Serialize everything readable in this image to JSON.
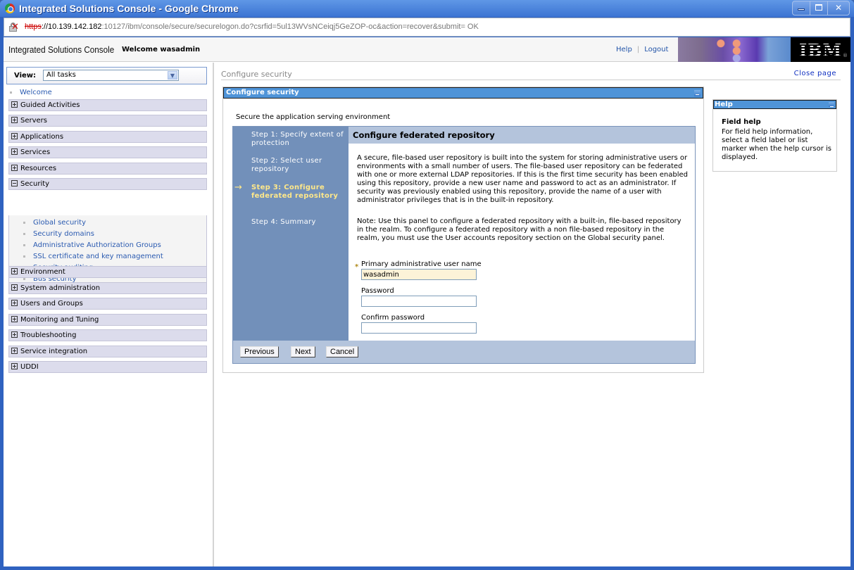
{
  "browser": {
    "window_title": "Integrated Solutions Console - Google Chrome",
    "url_protocol": "https",
    "url_host": "://10.139.142.182",
    "url_port": ":10127",
    "url_path": "/ibm/console/secure/securelogon.do?csrfid=5ul13WVsNCeiqj5GeZOP-oc&action=recover&submit= OK"
  },
  "banner": {
    "title": "Integrated Solutions Console",
    "welcome": "Welcome wasadmin",
    "help_link": "Help",
    "logout_link": "Logout",
    "separator": "|",
    "logo_text": "IBM",
    "logo_reg": "®"
  },
  "nav": {
    "view_label": "View:",
    "view_value": "All tasks",
    "welcome_link": "Welcome",
    "items": [
      {
        "label": "Guided Activities",
        "expanded": false
      },
      {
        "label": "Servers",
        "expanded": false
      },
      {
        "label": "Applications",
        "expanded": false
      },
      {
        "label": "Services",
        "expanded": false
      },
      {
        "label": "Resources",
        "expanded": false
      },
      {
        "label": "Security",
        "expanded": true
      },
      {
        "label": "Environment",
        "expanded": false
      },
      {
        "label": "System administration",
        "expanded": false
      },
      {
        "label": "Users and Groups",
        "expanded": false
      },
      {
        "label": "Monitoring and Tuning",
        "expanded": false
      },
      {
        "label": "Troubleshooting",
        "expanded": false
      },
      {
        "label": "Service integration",
        "expanded": false
      },
      {
        "label": "UDDI",
        "expanded": false
      }
    ],
    "security_links": [
      "Global security",
      "Security domains",
      "Administrative Authorization Groups",
      "SSL certificate and key management",
      "Security auditing",
      "Bus security"
    ]
  },
  "main": {
    "breadcrumb": "Configure security",
    "close_page": "Close page",
    "portlet_title": "Configure security",
    "intro": "Secure the application serving environment",
    "steps": [
      {
        "label": "Step 1: Specify extent of protection",
        "current": false
      },
      {
        "label": "Step 2: Select user repository",
        "current": false
      },
      {
        "label": "Step 3: Configure federated repository",
        "current": true
      },
      {
        "label": "Step 4: Summary",
        "current": false
      }
    ],
    "current_arrow": "→",
    "panel_title": "Configure federated repository",
    "description": "A secure, file-based user repository is built into the system for storing administrative users or environments with a small number of users. The file-based user repository can be federated with one or more external LDAP repositories. If this is the first time security has been enabled using this repository, provide a new user name and password to act as an administrator. If security was previously enabled using this repository, provide the name of a user with administrator privileges that is in the built-in repository.",
    "note": "Note: Use this panel to configure a federated repository with a built-in, file-based repository in the realm. To configure a federated repository with a non file-based repository in the realm, you must use the User accounts repository section on the Global security panel.",
    "required_marker": "*",
    "fields": {
      "username_label": "Primary administrative user name",
      "username_value": "wasadmin",
      "password_label": "Password",
      "password_value": "",
      "confirm_label": "Confirm password",
      "confirm_value": ""
    },
    "buttons": {
      "previous": "Previous",
      "next": "Next",
      "cancel": "Cancel"
    }
  },
  "help": {
    "title": "Help",
    "heading": "Field help",
    "text": "For field help information, select a field label or list marker when the help cursor is displayed."
  }
}
